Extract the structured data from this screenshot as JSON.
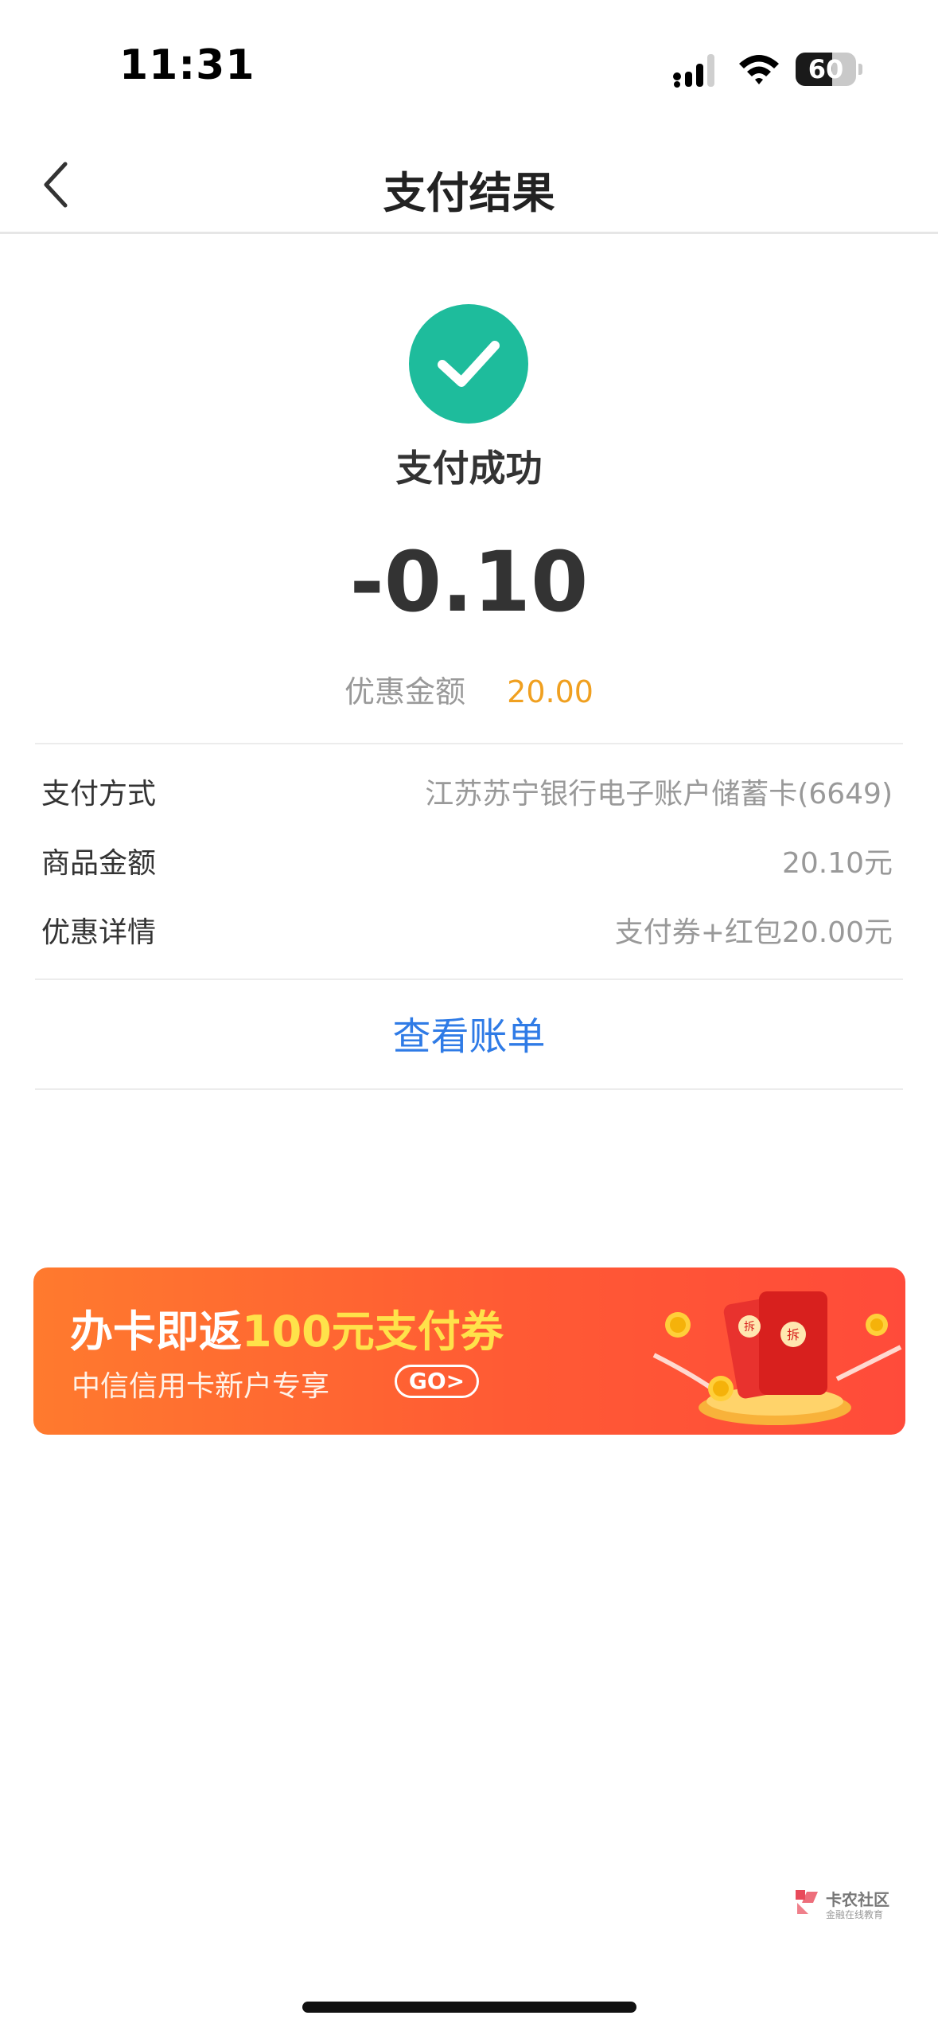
{
  "status_bar": {
    "time": "11:31",
    "battery_level": "60",
    "battery_fraction": 0.6
  },
  "nav": {
    "title": "支付结果",
    "back_icon": "chevron-left-icon"
  },
  "result": {
    "status_text": "支付成功",
    "amount": "-0.10",
    "discount_label": "优惠金额",
    "discount_value": "20.00",
    "success_color": "#1ebc9c"
  },
  "details": [
    {
      "label": "支付方式",
      "value": "江苏苏宁银行电子账户储蓄卡(6649)"
    },
    {
      "label": "商品金额",
      "value": "20.10元"
    },
    {
      "label": "优惠详情",
      "value": "支付券+红包20.00元"
    }
  ],
  "view_bill_label": "查看账单",
  "banner": {
    "headline_prefix": "办卡即返",
    "headline_highlight": "100元支付券",
    "subtitle": "中信信用卡新户专享",
    "go_label": "GO>",
    "art_badge_1": "拆",
    "art_badge_2": "拆"
  },
  "watermark": {
    "main": "卡农社区",
    "sub": "金融在线教育"
  },
  "colors": {
    "accent_blue": "#2f7be6",
    "discount_orange": "#f0a020",
    "banner_orange": "#ff5a34"
  }
}
